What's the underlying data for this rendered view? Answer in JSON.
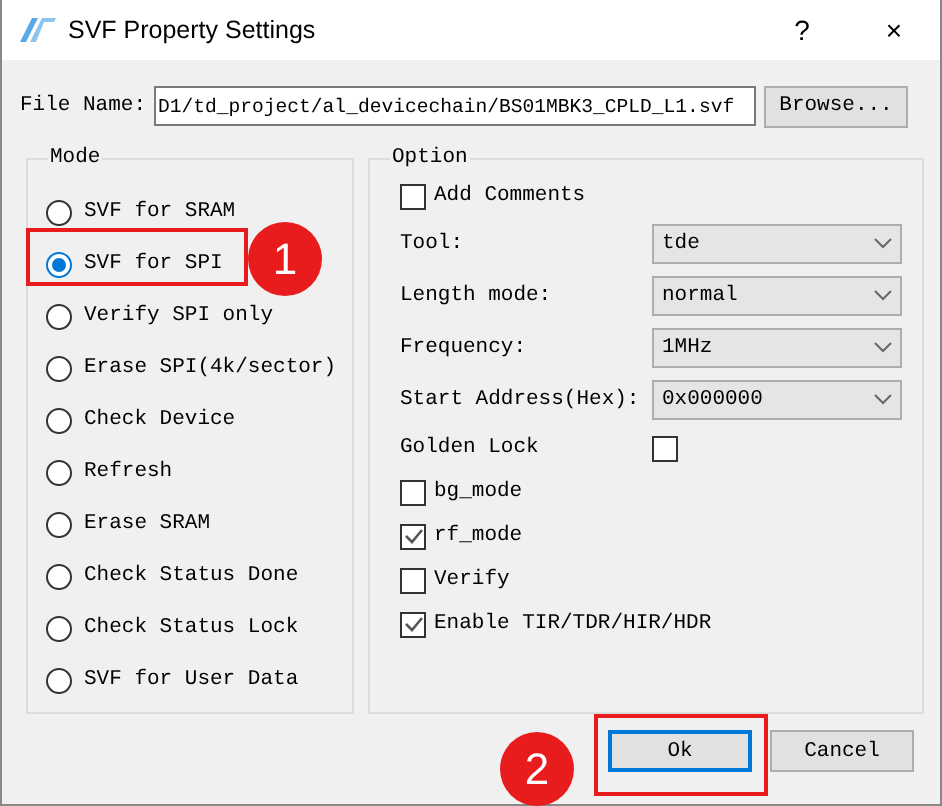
{
  "window": {
    "title": "SVF Property Settings",
    "help_button": "?",
    "close_button": "×"
  },
  "file_name": {
    "label": "File Name:",
    "value": "D1/td_project/al_devicechain/BS01MBK3_CPLD_L1.svf",
    "browse_button": "Browse..."
  },
  "mode": {
    "title": "Mode",
    "options": [
      {
        "label": "SVF for SRAM",
        "selected": false
      },
      {
        "label": "SVF for SPI",
        "selected": true
      },
      {
        "label": "Verify SPI only",
        "selected": false
      },
      {
        "label": "Erase SPI(4k/sector)",
        "selected": false
      },
      {
        "label": "Check Device",
        "selected": false
      },
      {
        "label": "Refresh",
        "selected": false
      },
      {
        "label": "Erase SRAM",
        "selected": false
      },
      {
        "label": "Check Status Done",
        "selected": false
      },
      {
        "label": "Check Status Lock",
        "selected": false
      },
      {
        "label": "SVF for User Data",
        "selected": false
      }
    ]
  },
  "option": {
    "title": "Option",
    "rows": [
      {
        "kind": "checkbox",
        "label": "Add Comments",
        "checked": false
      },
      {
        "kind": "select",
        "label": "Tool:",
        "value": "tde"
      },
      {
        "kind": "select",
        "label": "Length mode:",
        "value": "normal"
      },
      {
        "kind": "select",
        "label": "Frequency:",
        "value": "1MHz"
      },
      {
        "kind": "select",
        "label": "Start Address(Hex):",
        "value": "0x000000"
      },
      {
        "kind": "labeled-checkbox",
        "label": "Golden Lock",
        "checked": false
      },
      {
        "kind": "checkbox",
        "label": "bg_mode",
        "checked": false
      },
      {
        "kind": "checkbox",
        "label": "rf_mode",
        "checked": true
      },
      {
        "kind": "checkbox",
        "label": "Verify",
        "checked": false
      },
      {
        "kind": "checkbox",
        "label": "Enable TIR/TDR/HIR/HDR",
        "checked": true
      }
    ]
  },
  "buttons": [
    {
      "label": "Ok",
      "focused": true
    },
    {
      "label": "Cancel",
      "focused": false
    }
  ],
  "annotations": [
    {
      "number": "1"
    },
    {
      "number": "2"
    }
  ]
}
